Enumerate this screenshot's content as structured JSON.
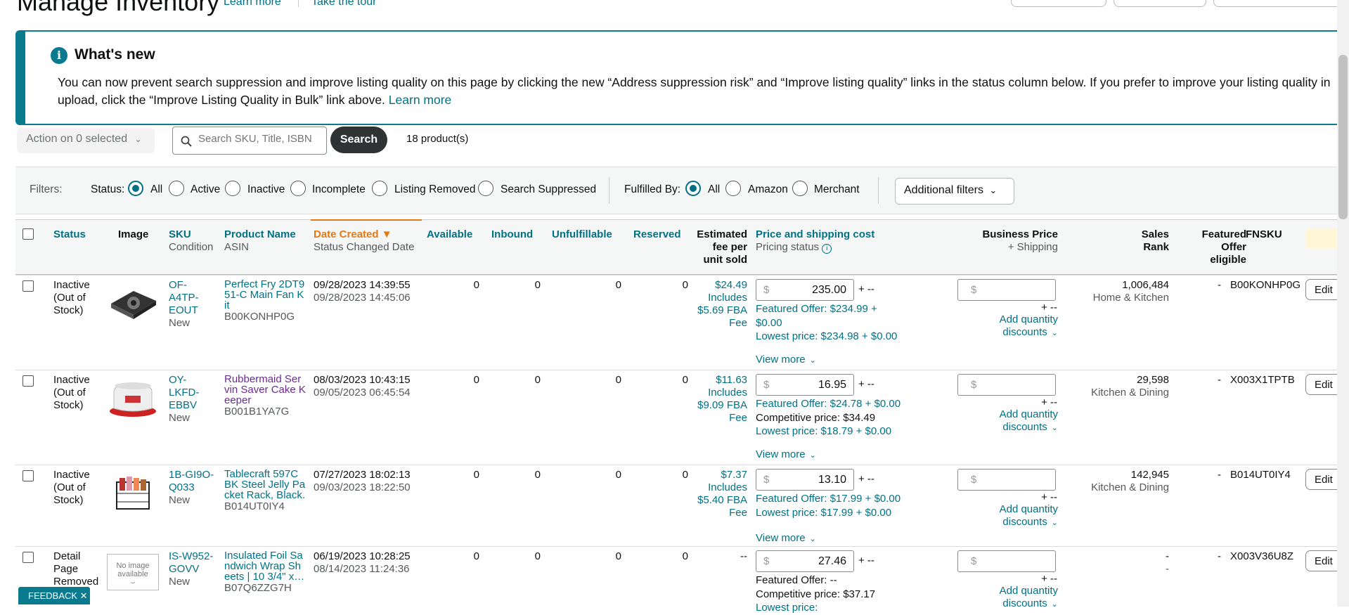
{
  "header": {
    "title": "Manage Inventory",
    "learn_more": "Learn more",
    "take_tour": "Take the tour"
  },
  "whats_new": {
    "title": "What's new",
    "body": "You can now prevent search suppression and improve listing quality on this page by clicking the new “Address suppression risk” and “Improve listing quality” links in the status column below. If you prefer to improve your listing quality in upload, click the “Improve Listing Quality in Bulk” link above.",
    "link": "Learn more"
  },
  "action_bar": {
    "action_label": "Action on 0 selected",
    "search_placeholder": "Search SKU, Title, ISBN",
    "search_button": "Search",
    "product_count": "18 product(s)"
  },
  "filters": {
    "label": "Filters:",
    "status_label": "Status:",
    "status_options": [
      "All",
      "Active",
      "Inactive",
      "Incomplete",
      "Listing Removed",
      "Search Suppressed"
    ],
    "status_selected": "All",
    "fulfilled_label": "Fulfilled By:",
    "fulfilled_options": [
      "All",
      "Amazon",
      "Merchant"
    ],
    "fulfilled_selected": "All",
    "additional": "Additional filters"
  },
  "columns": {
    "status": "Status",
    "image": "Image",
    "sku": "SKU",
    "condition": "Condition",
    "product_name": "Product Name",
    "asin": "ASIN",
    "date_created": "Date Created",
    "status_changed": "Status Changed Date",
    "available": "Available",
    "inbound": "Inbound",
    "unfulfillable": "Unfulfillable",
    "reserved": "Reserved",
    "est_fee_1": "Estimated",
    "est_fee_2": "fee per",
    "est_fee_3": "unit sold",
    "price": "Price and shipping cost",
    "pricing_status": "Pricing status",
    "business_price": "Business Price",
    "plus_shipping": "+ Shipping",
    "sales_rank": "Sales Rank",
    "featured_1": "Featured",
    "featured_2": "Offer",
    "featured_3": "eligible",
    "fnsku": "FNSKU"
  },
  "rows": [
    {
      "status_1": "Inactive",
      "status_2": "(Out of",
      "status_3": "Stock)",
      "sku_1": "OF-",
      "sku_2": "A4TP-",
      "sku_3": "EOUT",
      "condition": "New",
      "name_1": "Perfect Fry 2DT9",
      "name_2": "51-C Main Fan K",
      "name_3": "it",
      "asin": "B00KONHP0G",
      "date_created": "09/28/2023 14:39:55",
      "status_changed": "09/28/2023 14:45:06",
      "available": "0",
      "inbound": "0",
      "unfulfillable": "0",
      "reserved": "0",
      "fee_1": "$24.49",
      "fee_2": "Includes",
      "fee_3": "$5.69 FBA",
      "fee_4": "Fee",
      "price": "235.00",
      "price_suffix": "+ --",
      "featured": "Featured Offer: $234.99 +",
      "featured_b": "$0.00",
      "lowest": "Lowest price: $234.98 + $0.00",
      "competitive": "",
      "view_more": "View more",
      "bp_suffix": "+ --",
      "qty_1": "Add quantity",
      "qty_2": "discounts",
      "rank": "1,006,484",
      "category": "Home & Kitchen",
      "featured_eligible": "-",
      "fnsku": "B00KONHP0G",
      "edit": "Edit",
      "image": "cooling-fan-kit"
    },
    {
      "status_1": "Inactive",
      "status_2": "(Out of",
      "status_3": "Stock)",
      "sku_1": "OY-",
      "sku_2": "LKFD-",
      "sku_3": "EBBV",
      "condition": "New",
      "name_1": "Rubbermaid Ser",
      "name_2": "vin Saver Cake K",
      "name_3": "eeper",
      "asin": "B001B1YA7G",
      "date_created": "08/03/2023 10:43:15",
      "status_changed": "09/05/2023 06:45:54",
      "available": "0",
      "inbound": "0",
      "unfulfillable": "0",
      "reserved": "0",
      "fee_1": "$11.63",
      "fee_2": "Includes",
      "fee_3": "$9.09 FBA",
      "fee_4": "Fee",
      "price": "16.95",
      "price_suffix": "+ --",
      "featured": "Featured Offer: $24.78 + $0.00",
      "featured_b": "",
      "competitive": "Competitive price: $34.49",
      "lowest": "Lowest price: $18.79 + $0.00",
      "view_more": "View more",
      "bp_suffix": "+ --",
      "qty_1": "Add quantity",
      "qty_2": "discounts",
      "rank": "29,598",
      "category": "Kitchen & Dining",
      "featured_eligible": "-",
      "fnsku": "X003X1TPTB",
      "edit": "Edit",
      "image": "cake-keeper"
    },
    {
      "status_1": "Inactive",
      "status_2": "(Out of",
      "status_3": "Stock)",
      "sku_1": "1B-GI9O-",
      "sku_2": "Q033",
      "sku_3": "",
      "condition": "New",
      "name_1": "Tablecraft 597C",
      "name_2": "BK Steel Jelly Pa",
      "name_3": "cket Rack, Black.",
      "asin": "B014UT0IY4",
      "date_created": "07/27/2023 18:02:13",
      "status_changed": "09/03/2023 18:22:50",
      "available": "0",
      "inbound": "0",
      "unfulfillable": "0",
      "reserved": "0",
      "fee_1": "$7.37",
      "fee_2": "Includes",
      "fee_3": "$5.40 FBA",
      "fee_4": "Fee",
      "price": "13.10",
      "price_suffix": "+ --",
      "featured": "Featured Offer: $17.99 + $0.00",
      "featured_b": "",
      "competitive": "",
      "lowest": "Lowest price: $17.99 + $0.00",
      "view_more": "View more",
      "bp_suffix": "+ --",
      "qty_1": "Add quantity",
      "qty_2": "discounts",
      "rank": "142,945",
      "category": "Kitchen & Dining",
      "featured_eligible": "-",
      "fnsku": "B014UT0IY4",
      "edit": "Edit",
      "image": "jelly-packet-rack"
    },
    {
      "status_1": "Detail",
      "status_2": "Page",
      "status_3": "Removed",
      "sku_1": "IS-W952-",
      "sku_2": "GOVV",
      "sku_3": "",
      "condition": "New",
      "name_1": "Insulated Foil Sa",
      "name_2": "ndwich Wrap Sh",
      "name_3": "eets | 10 3/4\" x…",
      "asin": "B07Q6ZZG7H",
      "date_created": "06/19/2023 10:28:25",
      "status_changed": "08/14/2023 11:24:36",
      "available": "0",
      "inbound": "0",
      "unfulfillable": "0",
      "reserved": "0",
      "fee_1": "--",
      "price": "27.46",
      "price_suffix": "+ --",
      "featured": "Featured Offer: --",
      "competitive": "Competitive price: $37.17",
      "lowest": "Lowest price:",
      "bp_suffix": "+ --",
      "qty_1": "Add quantity",
      "qty_2": "discounts",
      "rank": "-",
      "category": "-",
      "featured_eligible": "-",
      "fnsku": "X003V36U8Z",
      "edit": "Edit",
      "image": "no-image-available",
      "no_image_1": "No image",
      "no_image_2": "available"
    }
  ],
  "feedback": "FEEDBACK ✕",
  "colors": {
    "teal": "#007185",
    "accent": "#0a7a8f",
    "sort": "#e47911"
  }
}
